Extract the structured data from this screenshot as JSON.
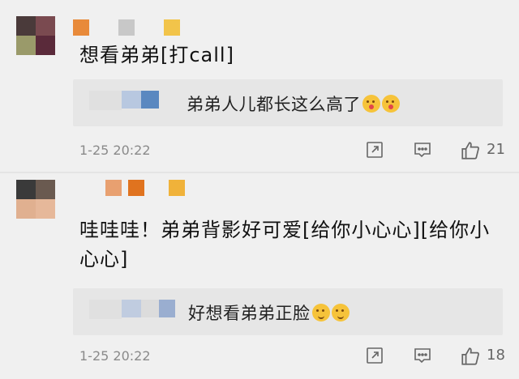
{
  "comments": [
    {
      "text": "想看弟弟[打call]",
      "reply_text": "弟弟人儿都长这么高了",
      "timestamp": "1-25 20:22",
      "like_count": "21",
      "reply_emojis": [
        "kiss-emoji",
        "kiss-emoji"
      ]
    },
    {
      "text": "哇哇哇！弟弟背影好可爱[给你小心心][给你小心心]",
      "reply_text": "好想看弟弟正脸",
      "timestamp": "1-25 20:22",
      "like_count": "18",
      "reply_emojis": [
        "thinking-emoji",
        "thinking-emoji"
      ]
    }
  ],
  "icons": {
    "share": "share-icon",
    "reply": "comment-icon",
    "like": "thumbs-up-icon"
  }
}
